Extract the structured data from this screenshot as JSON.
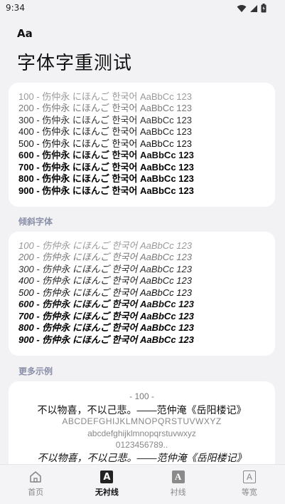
{
  "status_bar": {
    "time": "9:34"
  },
  "header": {
    "app_label": "Aa",
    "title": "字体字重测试"
  },
  "weights": [
    {
      "weight": "100",
      "cjk": " - 伤仲永 にほんご 한국어 ",
      "latin": "AaBbCc 123"
    },
    {
      "weight": "200",
      "cjk": " - 伤仲永 にほんご 한국어 ",
      "latin": "AaBbCc 123"
    },
    {
      "weight": "300",
      "cjk": " - 伤仲永 にほんご 한국어 ",
      "latin": "AaBbCc 123"
    },
    {
      "weight": "400",
      "cjk": " - 伤仲永 にほんご 한국어 ",
      "latin": "AaBbCc 123"
    },
    {
      "weight": "500",
      "cjk": " - 伤仲永 にほんご 한국어 ",
      "latin": "AaBbCc 123"
    },
    {
      "weight": "600",
      "cjk": " - 伤仲永 にほんご 한국어 ",
      "latin": "AaBbCc 123"
    },
    {
      "weight": "700",
      "cjk": " - 伤仲永 にほんご 한국어 ",
      "latin": "AaBbCc 123"
    },
    {
      "weight": "800",
      "cjk": " - 伤仲永 にほんご 한국어 ",
      "latin": "AaBbCc 123"
    },
    {
      "weight": "900",
      "cjk": " - 伤仲永 にほんご 한국어 ",
      "latin": "AaBbCc 123"
    }
  ],
  "italic_section": {
    "label": "倾斜字体"
  },
  "more_section": {
    "label": "更多示例",
    "weight_line": "- 100 -",
    "quote": "不以物喜，不以己悲。——范仲淹《岳阳楼记》",
    "uppercase": "ABCDEFGHIJKLMNOPQRSTUVWXYZ",
    "lowercase": "abcdefghijklmnopqrstuvwxyz",
    "digits": "0123456789..",
    "quote_italic": "不以物喜，不以己悲。——范仲淹《岳阳楼记》"
  },
  "bottom_nav": {
    "items": [
      {
        "label": "首页",
        "icon": "home-icon"
      },
      {
        "label": "无衬线",
        "icon": "sans-serif-icon",
        "glyph": "A"
      },
      {
        "label": "衬线",
        "icon": "serif-icon",
        "glyph": "A"
      },
      {
        "label": "等宽",
        "icon": "monospace-icon",
        "glyph": "A"
      }
    ],
    "active_index": 1
  }
}
